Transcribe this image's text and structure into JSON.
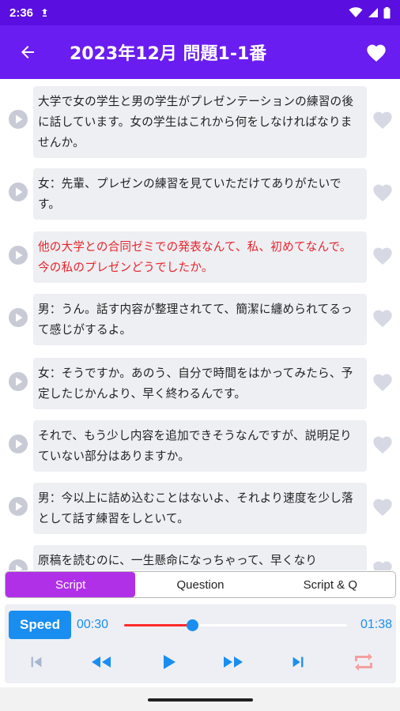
{
  "status_bar": {
    "time": "2:36"
  },
  "app_bar": {
    "title": "2023年12月 問題1-1番"
  },
  "rows": [
    {
      "text": "大学で女の学生と男の学生がプレゼンテーションの練習の後に話しています。女の学生はこれから何をしなければなりませんか。",
      "highlighted": false
    },
    {
      "text": "女：先輩、プレゼンの練習を見ていただけてありがたいです。",
      "highlighted": false
    },
    {
      "text": "他の大学との合同ゼミでの発表なんて、私、初めてなんで。今の私のプレゼンどうでしたか。",
      "highlighted": true
    },
    {
      "text": "男：うん。話す内容が整理されてて、簡潔に纏められてるって感じがするよ。",
      "highlighted": false
    },
    {
      "text": "女：そうですか。あのう、自分で時間をはかってみたら、予定したじかんより、早く終わるんです。",
      "highlighted": false
    },
    {
      "text": "それで、もう少し内容を追加できそうなんですが、説明足りていない部分はありますか。",
      "highlighted": false
    },
    {
      "text": "男：今以上に詰め込むことはないよ、それより速度を少し落として話す練習をしといて。",
      "highlighted": false
    },
    {
      "text": "原稿を読むのに、一生懸命になっちゃって、早くなり",
      "highlighted": false
    }
  ],
  "tabs": [
    {
      "label": "Script",
      "active": true
    },
    {
      "label": "Question",
      "active": false
    },
    {
      "label": "Script & Q",
      "active": false
    }
  ],
  "player": {
    "speed_label": "Speed",
    "current_time": "00:30",
    "total_time": "01:38",
    "progress": 0.306
  },
  "colors": {
    "status_bar": "#5a0fe0",
    "app_bar": "#6a1df0",
    "highlight_text": "#e8232b",
    "accent_blue": "#1a8ef0",
    "active_tab": "#b030e8",
    "progress_fill": "#ff2a2a",
    "repeat_icon": "#f4a0a0"
  },
  "icons": {
    "back": "arrow-left-icon",
    "favorite": "heart-icon",
    "row_play": "play-circle-icon",
    "row_favorite": "heart-outline-icon",
    "skip_previous": "skip-previous-icon",
    "rewind": "rewind-icon",
    "play": "play-icon",
    "fast_forward": "fast-forward-icon",
    "skip_next": "skip-next-icon",
    "repeat": "repeat-icon"
  }
}
